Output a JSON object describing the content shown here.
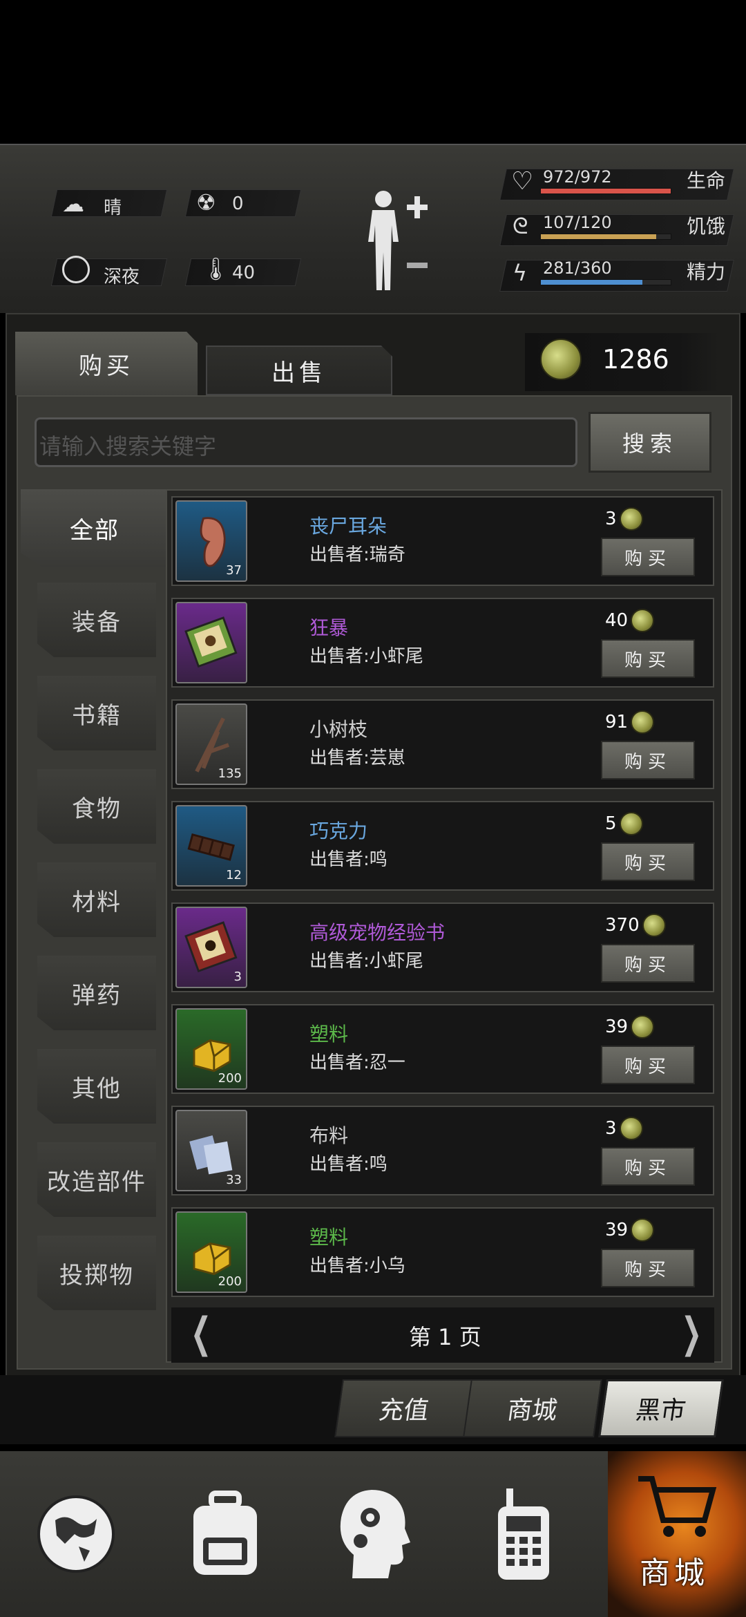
{
  "hud": {
    "weather": "晴",
    "radiation": "0",
    "time_of_day": "深夜",
    "temperature": "40",
    "health": {
      "label": "生命",
      "value": "972/972",
      "fraction": 1.0,
      "color": "#d9544a"
    },
    "hunger": {
      "label": "饥饿",
      "value": "107/120",
      "fraction": 0.89,
      "color": "#c9a154"
    },
    "energy": {
      "label": "精力",
      "value": "281/360",
      "fraction": 0.78,
      "color": "#4e8fd1"
    }
  },
  "shop": {
    "tabs": {
      "buy": "购买",
      "sell": "出售"
    },
    "coins": "1286",
    "search": {
      "placeholder": "请输入搜索关键字",
      "button": "搜索"
    },
    "categories": [
      "全部",
      "装备",
      "书籍",
      "食物",
      "材料",
      "弹药",
      "其他",
      "改造部件",
      "投掷物"
    ],
    "items": [
      {
        "name": "丧尸耳朵",
        "seller": "出售者:瑞奇",
        "price": "3",
        "qty": "37",
        "rarity_color": "#6aa8e0",
        "icon": "ear-icon"
      },
      {
        "name": "狂暴",
        "seller": "出售者:小虾尾",
        "price": "40",
        "qty": "",
        "rarity_color": "#b05ad8",
        "icon": "book-icon"
      },
      {
        "name": "小树枝",
        "seller": "出售者:芸崽",
        "price": "91",
        "qty": "135",
        "rarity_color": "#cfcfcf",
        "icon": "twigs-icon"
      },
      {
        "name": "巧克力",
        "seller": "出售者:鸣",
        "price": "5",
        "qty": "12",
        "rarity_color": "#6aa8e0",
        "icon": "chocolate-icon"
      },
      {
        "name": "高级宠物经验书",
        "seller": "出售者:小虾尾",
        "price": "370",
        "qty": "3",
        "rarity_color": "#b05ad8",
        "icon": "pet-book-icon"
      },
      {
        "name": "塑料",
        "seller": "出售者:忍一",
        "price": "39",
        "qty": "200",
        "rarity_color": "#5cb84a",
        "icon": "plastic-icon"
      },
      {
        "name": "布料",
        "seller": "出售者:鸣",
        "price": "3",
        "qty": "33",
        "rarity_color": "#cfcfcf",
        "icon": "cloth-icon"
      },
      {
        "name": "塑料",
        "seller": "出售者:小乌",
        "price": "39",
        "qty": "200",
        "rarity_color": "#5cb84a",
        "icon": "plastic-icon"
      }
    ],
    "buy_label": "购买",
    "page_label": "第 1 页"
  },
  "bottom_tabs": [
    "充值",
    "商城",
    "黑市"
  ],
  "nav": {
    "shop_label": "商城"
  }
}
